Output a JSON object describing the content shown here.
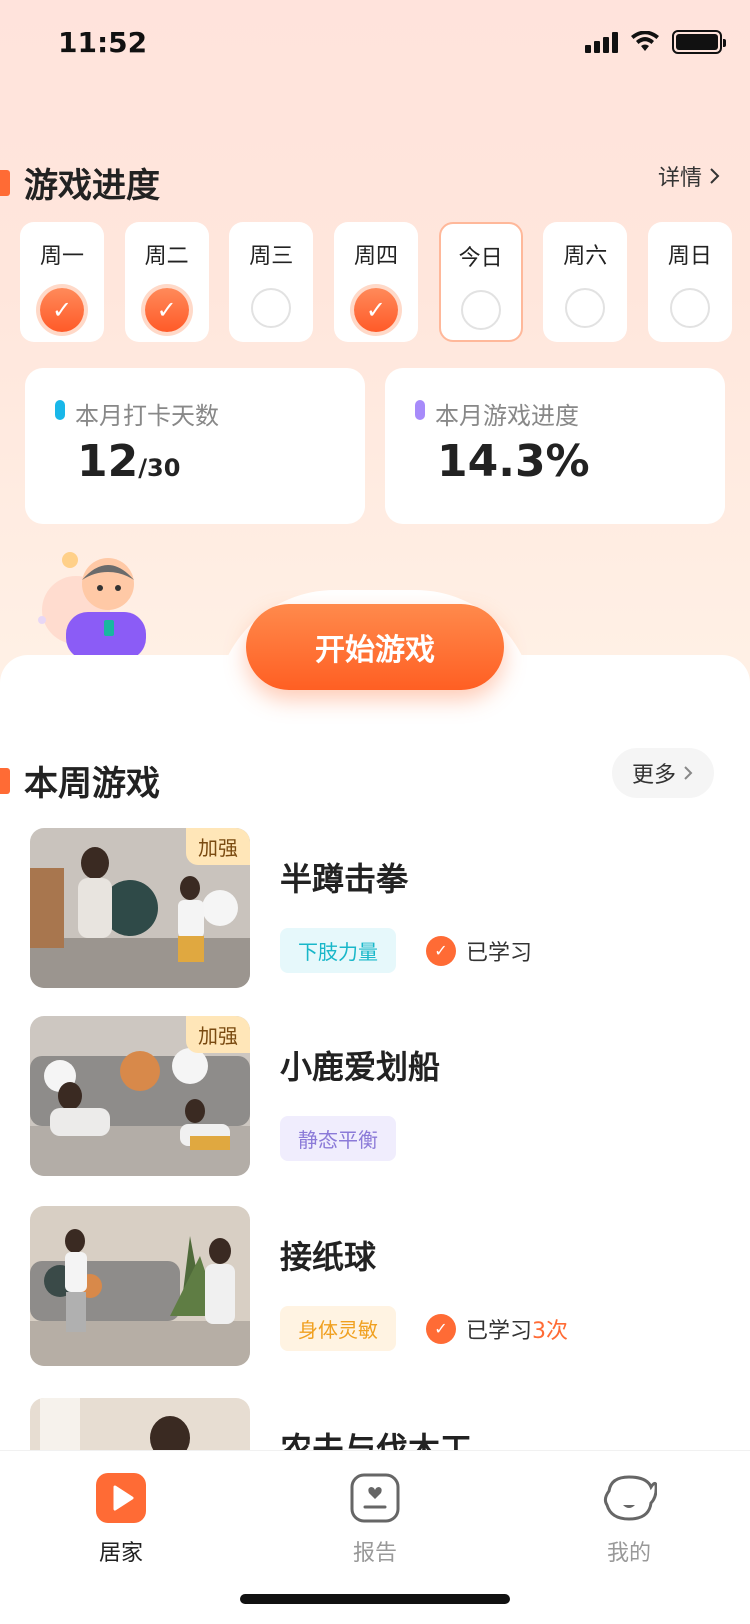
{
  "status": {
    "time": "11:52"
  },
  "progress_section": {
    "title": "游戏进度",
    "detail_label": "详情",
    "days": [
      {
        "label": "周一",
        "checked": true,
        "today": false
      },
      {
        "label": "周二",
        "checked": true,
        "today": false
      },
      {
        "label": "周三",
        "checked": false,
        "today": false
      },
      {
        "label": "周四",
        "checked": true,
        "today": false
      },
      {
        "label": "今日",
        "checked": false,
        "today": true
      },
      {
        "label": "周六",
        "checked": false,
        "today": false
      },
      {
        "label": "周日",
        "checked": false,
        "today": false
      }
    ]
  },
  "stats": {
    "checkin": {
      "label": "本月打卡天数",
      "value": "12",
      "total": "/30",
      "dot_color": "#19b7e9"
    },
    "progress": {
      "label": "本月游戏进度",
      "value": "14.3%",
      "dot_color": "#a78bfa"
    }
  },
  "start_button": {
    "label": "开始游戏"
  },
  "weekly_section": {
    "title": "本周游戏",
    "more_label": "更多"
  },
  "games": [
    {
      "title": "半蹲击拳",
      "badge": "加强",
      "tag": "下肢力量",
      "tag_bg": "#e6f8fb",
      "tag_color": "#19b7c9",
      "learned": "已学习",
      "count": ""
    },
    {
      "title": "小鹿爱划船",
      "badge": "加强",
      "tag": "静态平衡",
      "tag_bg": "#f0edfd",
      "tag_color": "#8b7ad8",
      "learned": "",
      "count": ""
    },
    {
      "title": "接纸球",
      "badge": "",
      "tag": "身体灵敏",
      "tag_bg": "#fff3e2",
      "tag_color": "#f0a020",
      "learned": "已学习",
      "count": "3次"
    },
    {
      "title": "农夫与伐木工",
      "badge": "",
      "tag": "",
      "tag_bg": "",
      "tag_color": "",
      "learned": "",
      "count": ""
    }
  ],
  "bottom_nav": {
    "items": [
      {
        "label": "居家",
        "icon": "play-icon",
        "active": true
      },
      {
        "label": "报告",
        "icon": "report-icon",
        "active": false
      },
      {
        "label": "我的",
        "icon": "profile-icon",
        "active": false
      }
    ]
  },
  "colors": {
    "accent": "#ff6b35"
  }
}
